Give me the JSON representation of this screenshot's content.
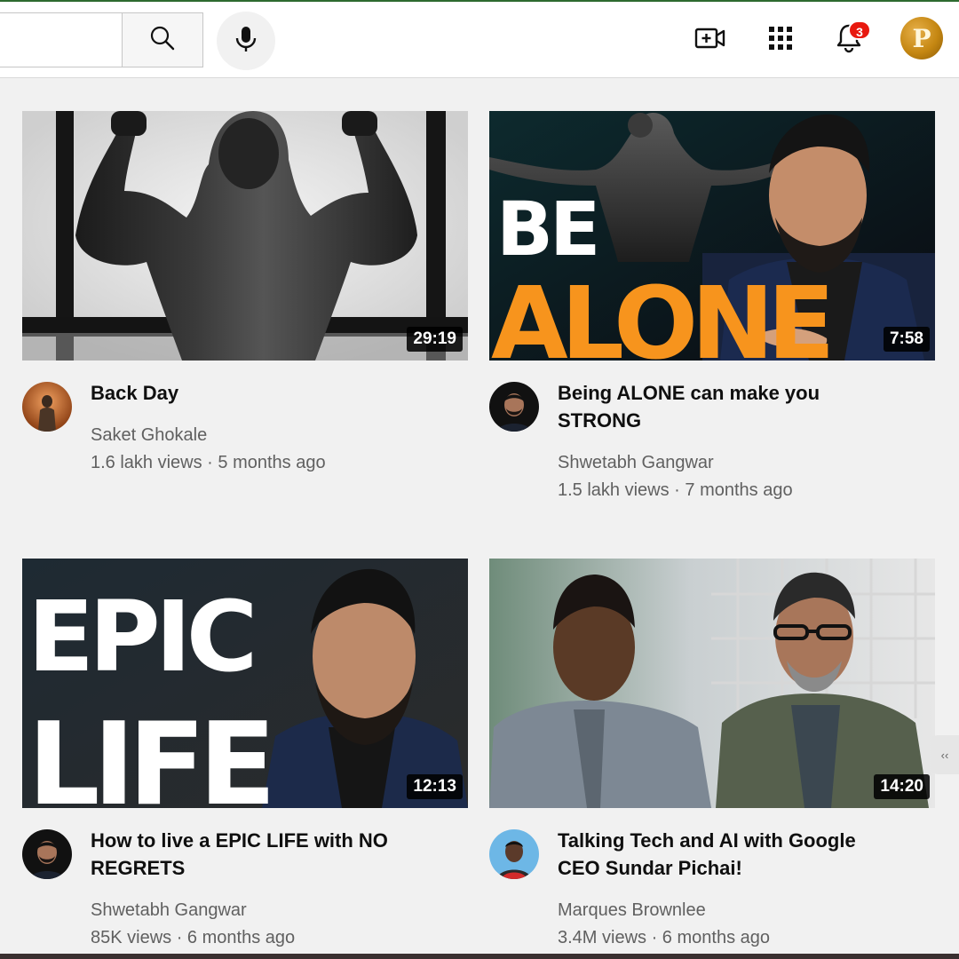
{
  "header": {
    "search": {
      "value": "",
      "placeholder": ""
    },
    "notification_count": "3",
    "avatar_letter": "P",
    "icons": [
      "search-icon",
      "mic-icon",
      "create-video-icon",
      "apps-grid-icon",
      "bell-icon"
    ]
  },
  "videos": [
    {
      "title": "Back Day",
      "channel": "Saket Ghokale",
      "stats": "1.6 lakh views · 5 months ago",
      "duration": "29:19"
    },
    {
      "title": "Being ALONE can make you STRONG",
      "channel": "Shwetabh Gangwar",
      "stats": "1.5 lakh views · 7 months ago",
      "duration": "7:58",
      "thumb_text": {
        "line1": "BE",
        "line2": "ALONE"
      }
    },
    {
      "title": "How to live a EPIC LIFE with NO REGRETS",
      "channel": "Shwetabh Gangwar",
      "stats": "85K views · 6 months ago",
      "duration": "12:13",
      "thumb_text": {
        "line1": "EPIC",
        "line2": "LIFE"
      }
    },
    {
      "title": "Talking Tech and AI with Google CEO Sundar Pichai!",
      "channel": "Marques Brownlee",
      "stats": "3.4M views · 6 months ago",
      "duration": "14:20"
    }
  ],
  "colors": {
    "accent_orange": "#f7941d",
    "badge_red": "#e8190f",
    "avatar_gold": "#c58712",
    "page_bg": "#f1f1f1"
  }
}
